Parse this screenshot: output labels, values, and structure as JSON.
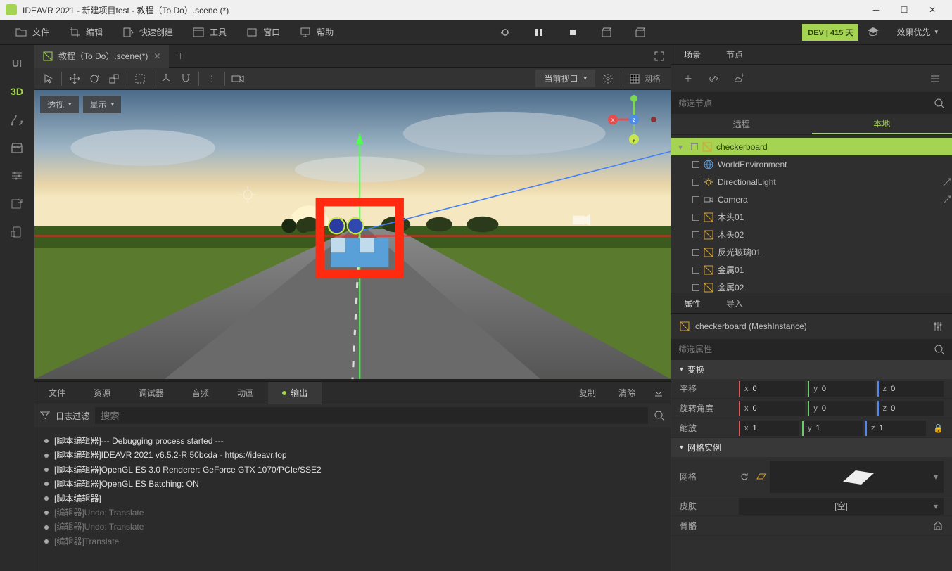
{
  "titlebar": {
    "title": "IDEAVR 2021 - 新建项目test - 教程（To Do）.scene (*)"
  },
  "menubar": {
    "file": "文件",
    "edit": "编辑",
    "quick": "快速创建",
    "tools": "工具",
    "window": "窗口",
    "help": "帮助",
    "effects": "效果优先",
    "dev_badge": "DEV | 415 天"
  },
  "rail": {
    "ui": "UI",
    "three_d": "3D"
  },
  "scene_tab": {
    "label": "教程（To Do）.scene(*)"
  },
  "vp_toolbar": {
    "viewport_label": "当前视口",
    "grid_label": "网格"
  },
  "vp_controls": {
    "persp": "透视",
    "display": "显示"
  },
  "axis": {
    "x": "x",
    "y": "y",
    "z": "z"
  },
  "bottom": {
    "tabs": {
      "file": "文件",
      "resource": "资源",
      "debugger": "调试器",
      "audio": "音频",
      "anim": "动画",
      "output": "输出"
    },
    "actions": {
      "copy": "复制",
      "clear": "清除"
    },
    "filter_label": "日志过滤",
    "search_placeholder": "搜索",
    "logs": [
      {
        "cls": "white",
        "text": "[脚本编辑器]--- Debugging process started ---"
      },
      {
        "cls": "white",
        "text": "[脚本编辑器]IDEAVR 2021 v6.5.2-R 50bcda - https://ideavr.top"
      },
      {
        "cls": "white",
        "text": "[脚本编辑器]OpenGL ES 3.0 Renderer: GeForce GTX 1070/PCIe/SSE2"
      },
      {
        "cls": "white",
        "text": "[脚本编辑器]OpenGL ES Batching: ON"
      },
      {
        "cls": "white",
        "text": "[脚本编辑器]"
      },
      {
        "cls": "gray",
        "text": "[编辑器]Undo: Translate"
      },
      {
        "cls": "gray",
        "text": "[编辑器]Undo: Translate"
      },
      {
        "cls": "gray",
        "text": "[编辑器]Translate"
      }
    ]
  },
  "scene_panel": {
    "tabs": {
      "scene": "场景",
      "node": "节点"
    },
    "filter_placeholder": "筛选节点",
    "subtabs": {
      "remote": "远程",
      "local": "本地"
    },
    "nodes": [
      {
        "name": "checkerboard",
        "selected": true,
        "root": true,
        "icon": "mesh"
      },
      {
        "name": "WorldEnvironment",
        "icon": "env"
      },
      {
        "name": "DirectionalLight",
        "icon": "light",
        "badge": true
      },
      {
        "name": "Camera",
        "icon": "camera",
        "badge": true
      },
      {
        "name": "木头01",
        "icon": "mesh"
      },
      {
        "name": "木头02",
        "icon": "mesh"
      },
      {
        "name": "反光玻璃01",
        "icon": "mesh"
      },
      {
        "name": "金属01",
        "icon": "mesh"
      },
      {
        "name": "金属02",
        "icon": "mesh"
      }
    ]
  },
  "inspector": {
    "tabs": {
      "props": "属性",
      "import": "导入"
    },
    "header": "checkerboard  (MeshInstance)",
    "filter_placeholder": "筛选属性",
    "sections": {
      "transform": "变换",
      "mesh_instance": "网格实例"
    },
    "rows": {
      "translate": {
        "label": "平移",
        "x": "0",
        "y": "0",
        "z": "0"
      },
      "rotate": {
        "label": "旋转角度",
        "x": "0",
        "y": "0",
        "z": "0"
      },
      "scale": {
        "label": "缩放",
        "x": "1",
        "y": "1",
        "z": "1"
      }
    },
    "mesh_label": "网格",
    "skin_label": "皮肤",
    "skin_value": "[空]",
    "skeleton_label": "骨骼"
  }
}
